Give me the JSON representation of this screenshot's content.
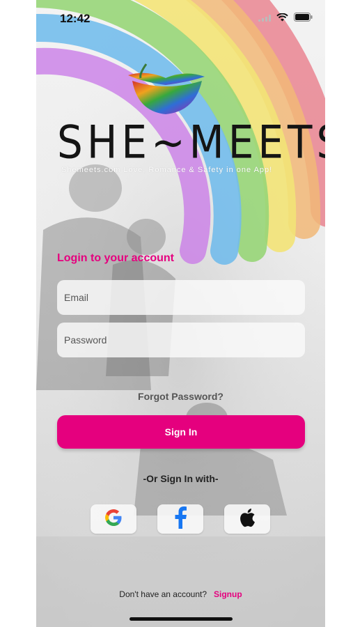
{
  "status_bar": {
    "time": "12:42",
    "icons": [
      "signal-icon",
      "wifi-icon",
      "battery-icon"
    ]
  },
  "brand": {
    "name": "SHE~MEETS",
    "tagline": "Shemeets.com Love, Romance & Safety in one App!"
  },
  "login": {
    "title": "Login to your account",
    "email_placeholder": "Email",
    "password_placeholder": "Password",
    "forgot_label": "Forgot Password?",
    "signin_label": "Sign In",
    "or_label": "-Or Sign In with-"
  },
  "social": {
    "google_icon": "google-icon",
    "facebook_icon": "facebook-icon",
    "apple_icon": "apple-icon"
  },
  "footer": {
    "prompt": "Don't have an account?",
    "signup_label": "Signup"
  },
  "colors": {
    "accent": "#e5007e",
    "rainbow": [
      "#e86a7a",
      "#f2b36b",
      "#f4e36a",
      "#8fd46b",
      "#67b8ec",
      "#c979e8"
    ]
  }
}
